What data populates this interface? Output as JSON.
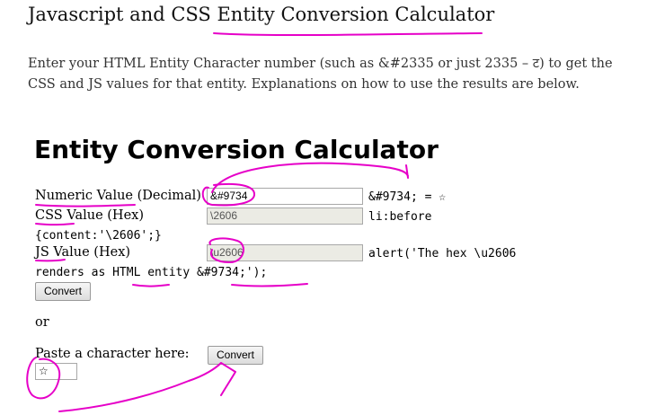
{
  "page": {
    "title": "Javascript and CSS Entity Conversion Calculator",
    "intro": "Enter your HTML Entity Character number (such as &#2335 or just 2335 – ट) to get the CSS and JS values for that entity. Explanations on how to use the results are below."
  },
  "calculator": {
    "heading": "Entity Conversion Calculator",
    "numeric_label": "Numeric Value (Decimal)",
    "numeric_value": "&#9734",
    "numeric_result": "&#9734; = ☆",
    "css_label": "CSS Value (Hex)",
    "css_value": "\\2606",
    "css_result_1": "li:before",
    "css_result_2": "{content:'\\2606';}",
    "js_label": "JS Value (Hex)",
    "js_value": "\\u2606",
    "js_result_1": "alert('The hex \\u2606",
    "js_result_2": "renders as HTML entity &#9734;');",
    "convert_label": "Convert",
    "or_label": "or",
    "paste_label": "Paste a character here:",
    "paste_value": "☆",
    "convert2_label": "Convert"
  },
  "annotation": {
    "color": "#e600c8"
  }
}
